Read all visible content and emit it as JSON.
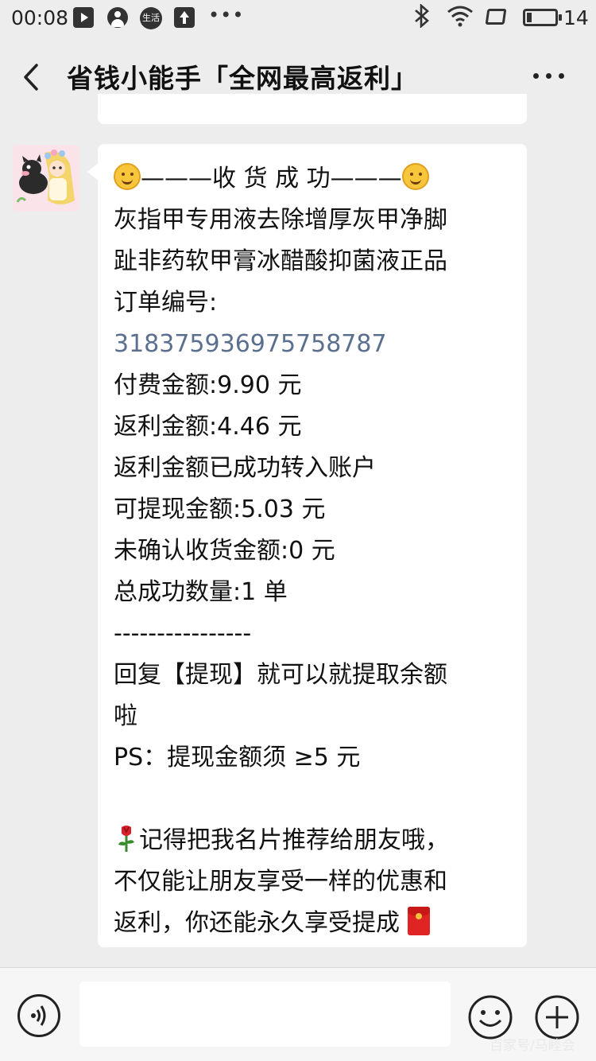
{
  "status_bar": {
    "time": "00:08",
    "life_label": "生活",
    "battery_level": "14",
    "icons": [
      "video-play-icon",
      "user-icon",
      "life-icon",
      "upload-icon",
      "more-dots-icon",
      "bluetooth-icon",
      "wifi-icon",
      "rotate-icon",
      "battery-icon"
    ]
  },
  "header": {
    "title": "省钱小能手「全网最高返利」"
  },
  "message": {
    "lines": [
      "———收 货 成 功———",
      "灰指甲专用液去除增厚灰甲净脚",
      "趾非药软甲膏冰醋酸抑菌液正品",
      "订单编号:",
      "318375936975758787",
      "付费金额:9.90 元",
      "返利金额:4.46 元",
      "返利金额已成功转入账户",
      "可提现金额:5.03 元",
      "未确认收货金额:0 元",
      "总成功数量:1 单",
      "----------------",
      "回复【提现】就可以就提取余额",
      "啦",
      "PS：提现金额须 ≥5 元",
      "",
      "记得把我名片推荐给朋友哦，",
      "不仅能让朋友享受一样的优惠和",
      "返利，你还能永久享受提成"
    ]
  },
  "input_bar": {
    "placeholder": ""
  },
  "watermark": "百家号/马睦会",
  "colors": {
    "background": "#ededed",
    "bubble": "#ffffff",
    "order_number": "#5b6f8f"
  }
}
